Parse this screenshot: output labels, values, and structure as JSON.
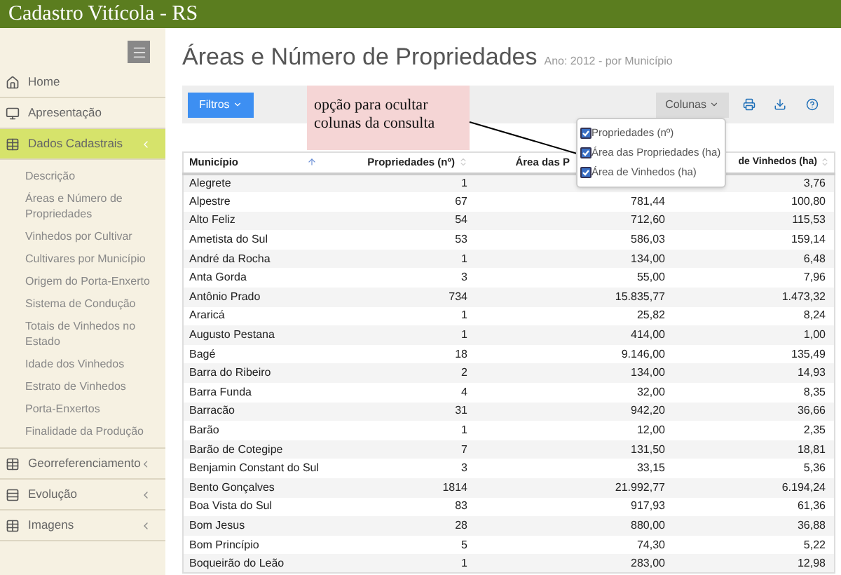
{
  "app_title": "Cadastro Vitícola - RS",
  "sidebar": {
    "items": [
      {
        "label": "Home",
        "selected": false,
        "has_children": false
      },
      {
        "label": "Apresentação",
        "selected": false,
        "has_children": false
      },
      {
        "label": "Dados Cadastrais",
        "selected": true,
        "has_children": true,
        "children": [
          {
            "label": "Descrição"
          },
          {
            "label": "Áreas e Número de Propriedades"
          },
          {
            "label": "Vinhedos por Cultivar"
          },
          {
            "label": "Cultivares por Município"
          },
          {
            "label": "Origem do Porta-Enxerto"
          },
          {
            "label": "Sistema de Condução"
          },
          {
            "label": "Totais de Vinhedos no Estado"
          },
          {
            "label": "Idade dos Vinhedos"
          },
          {
            "label": "Estrato de Vinhedos"
          },
          {
            "label": "Porta-Enxertos"
          },
          {
            "label": "Finalidade da Produção"
          }
        ]
      },
      {
        "label": "Georreferenciamento",
        "selected": false,
        "has_children": true
      },
      {
        "label": "Evolução",
        "selected": false,
        "has_children": true
      },
      {
        "label": "Imagens",
        "selected": false,
        "has_children": true
      }
    ]
  },
  "page": {
    "title": "Áreas e Número de Propriedades",
    "subtitle": "Ano: 2012 - por Município"
  },
  "toolbar": {
    "filter_button": "Filtros",
    "columns_button": "Colunas"
  },
  "annotation": "opção para ocultar colunas da consulta",
  "columns_menu": [
    {
      "label": "Propriedades (nº)",
      "checked": true
    },
    {
      "label": "Área das Propriedades (ha)",
      "checked": true
    },
    {
      "label": "Área de Vinhedos (ha)",
      "checked": true
    }
  ],
  "table": {
    "columns": [
      {
        "label": "Município",
        "sorted": true
      },
      {
        "label": "Propriedades (nº)",
        "sorted": false
      },
      {
        "label": "Área das P",
        "sorted": false
      },
      {
        "label": "de Vinhedos (ha)",
        "sorted": false
      }
    ],
    "rows": [
      [
        "Alegrete",
        "1",
        null,
        "3,76"
      ],
      [
        "Alpestre",
        "67",
        "781,44",
        "100,80"
      ],
      [
        "Alto Feliz",
        "54",
        "712,60",
        "115,53"
      ],
      [
        "Ametista do Sul",
        "53",
        "586,03",
        "159,14"
      ],
      [
        "André da Rocha",
        "1",
        "134,00",
        "6,48"
      ],
      [
        "Anta Gorda",
        "3",
        "55,00",
        "7,96"
      ],
      [
        "Antônio Prado",
        "734",
        "15.835,77",
        "1.473,32"
      ],
      [
        "Araricá",
        "1",
        "25,82",
        "8,24"
      ],
      [
        "Augusto Pestana",
        "1",
        "414,00",
        "1,00"
      ],
      [
        "Bagé",
        "18",
        "9.146,00",
        "135,49"
      ],
      [
        "Barra do Ribeiro",
        "2",
        "134,00",
        "14,93"
      ],
      [
        "Barra Funda",
        "4",
        "32,00",
        "8,35"
      ],
      [
        "Barracão",
        "31",
        "942,20",
        "36,66"
      ],
      [
        "Barão",
        "1",
        "12,00",
        "2,35"
      ],
      [
        "Barão de Cotegipe",
        "7",
        "131,50",
        "18,81"
      ],
      [
        "Benjamin Constant do Sul",
        "3",
        "33,15",
        "5,36"
      ],
      [
        "Bento Gonçalves",
        "1814",
        "21.992,77",
        "6.194,24"
      ],
      [
        "Boa Vista do Sul",
        "83",
        "917,93",
        "61,36"
      ],
      [
        "Bom Jesus",
        "28",
        "880,00",
        "36,88"
      ],
      [
        "Bom Princípio",
        "5",
        "74,30",
        "5,22"
      ],
      [
        "Boqueirão do Leão",
        "1",
        "283,00",
        "12,98"
      ]
    ]
  }
}
